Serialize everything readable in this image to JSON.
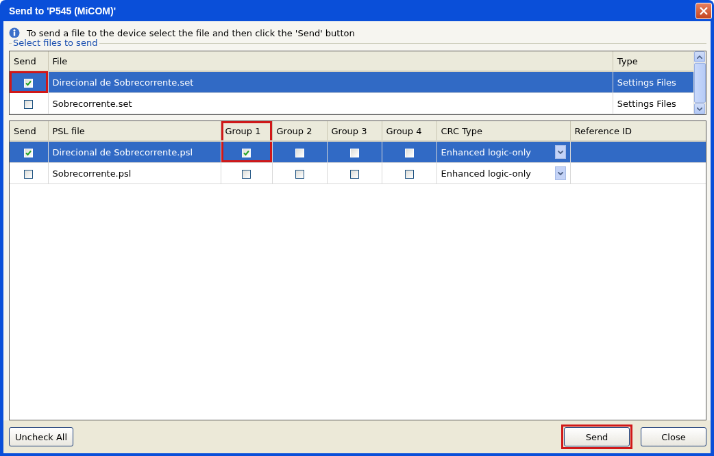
{
  "window": {
    "title": "Send to 'P545 (MiCOM)'"
  },
  "info": "To send a file to the device select the file and then click the 'Send' button",
  "group_label": "Select files to send",
  "files_table": {
    "columns": [
      {
        "label": "Send",
        "kind": "check"
      },
      {
        "label": "File",
        "kind": "text"
      },
      {
        "label": "Type",
        "kind": "text"
      }
    ],
    "rows": [
      {
        "selected": true,
        "checked": true,
        "highlighted": true,
        "file": "Direcional de Sobrecorrente.set",
        "type": "Settings Files"
      },
      {
        "selected": false,
        "checked": false,
        "highlighted": false,
        "file": "Sobrecorrente.set",
        "type": "Settings Files"
      }
    ]
  },
  "psl_table": {
    "columns": [
      {
        "label": "Send",
        "kind": "check",
        "highlighted": false
      },
      {
        "label": "PSL file",
        "kind": "text",
        "highlighted": false
      },
      {
        "label": "Group 1",
        "kind": "group",
        "highlighted": true
      },
      {
        "label": "Group 2",
        "kind": "group",
        "highlighted": false
      },
      {
        "label": "Group 3",
        "kind": "group",
        "highlighted": false
      },
      {
        "label": "Group 4",
        "kind": "group",
        "highlighted": false
      },
      {
        "label": "CRC Type",
        "kind": "dropdown",
        "highlighted": false
      },
      {
        "label": "Reference ID",
        "kind": "text",
        "highlighted": false
      }
    ],
    "rows": [
      {
        "selected": true,
        "checked": true,
        "highlighted": true,
        "file": "Direcional de Sobrecorrente.psl",
        "groups": [
          true,
          false,
          false,
          false
        ],
        "crc_type": "Enhanced logic-only"
      },
      {
        "selected": false,
        "checked": false,
        "highlighted": false,
        "file": "Sobrecorrente.psl",
        "groups": [
          false,
          false,
          false,
          false
        ],
        "crc_type": "Enhanced logic-only"
      }
    ]
  },
  "left_buttons": [
    {
      "label": "Uncheck All",
      "highlighted": false
    }
  ],
  "right_buttons": [
    {
      "label": "Send",
      "highlighted": true
    },
    {
      "label": "Close",
      "highlighted": false
    }
  ]
}
